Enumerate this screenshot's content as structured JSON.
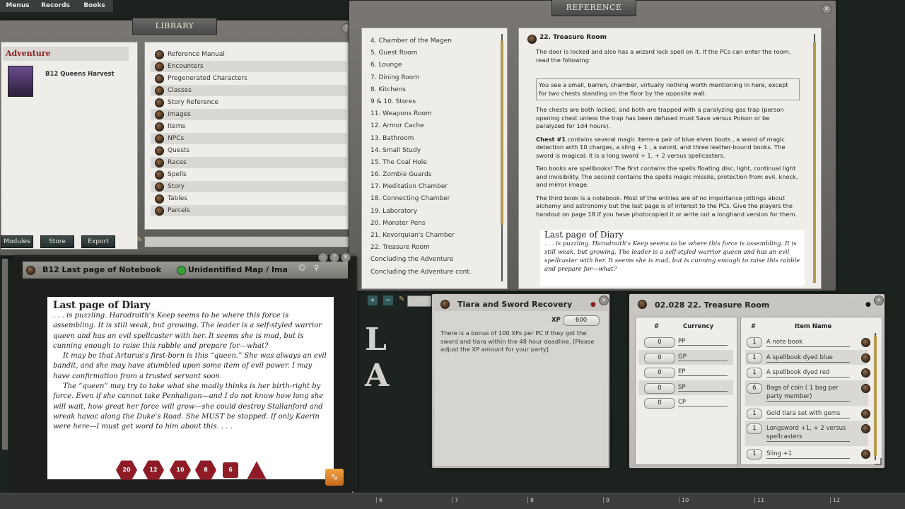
{
  "top_menu": [
    "Menus",
    "Records",
    "Books"
  ],
  "library": {
    "title": "LIBRARY",
    "adventure_header": "Adventure",
    "module_name": "B12 Queens Harvest",
    "items": [
      "Reference Manual",
      "Encounters",
      "Pregenerated Characters",
      "Classes",
      "Story Reference",
      "Images",
      "Items",
      "NPCs",
      "Quests",
      "Races",
      "Spells",
      "Story",
      "Tables",
      "Parcels"
    ],
    "buttons": {
      "modules": "Modules",
      "store": "Store",
      "export": "Export"
    }
  },
  "reference": {
    "title": "REFERENCE",
    "list": [
      "4. Chamber of the Magen",
      "5. Guest Room",
      "6. Lounge",
      "7. Dining Room",
      "8. Kitchens",
      "9 & 10. Stores",
      "11. Weapons Room",
      "12. Armor Cache",
      "13. Bathroom",
      "14. Small Study",
      "15. The Coal Hole",
      "16. Zombie Guards",
      "17. Meditation Chamber",
      "18. Connecting Chamber",
      "19. Laboratory",
      "20. Monster Pens",
      "21. Kevorquian's Chamber",
      "22. Treasure Room",
      "Concluding the Adventure",
      "Concluding the Adventure cont."
    ],
    "page_title": "22. Treasure Room",
    "para1": "The door is locked and also has a wizard lock spell on it. If the PCs can enter the room, read the following:",
    "boxed": "You see a small, barren, chamber, virtually nothing worth mentioning in here, except for two chests standing on the floor by the opposite wall.",
    "para2": "The chests are both locked, and both are trapped with a paralyzing gas trap (person opening chest unless the trap has been defused must Save versus Poison or be paralyzed for 1d4 hours).",
    "para3_bold": "Chest #1",
    "para3": " contains several magic items-a pair of blue elven boots , a wand of magic detection with 10 charges, a sling + 1 , a sword, and three leather-bound books. The sword is magical: it is a long sword + 1, + 2 versus spellcasters.",
    "para4": "Two books are spellbooks! The first contains the spells floating disc, light, continual light and invisibility. The second contains the spells magic missile, protection from evil, knock, and mirror image.",
    "para5": "The third book is a notebook. Most of the entries are of no importance jottings about alchemy and astronomy but the last page is of interest to the PCs. Give the players the handout on page 18 if you have photocopied it or write out a longhand version for them.",
    "diary_title": "Last page of Diary",
    "diary_text": ". . . is puzzling. Haradraith's Keep seems to be where this force is assembling. It is still weak, but growing. The leader is a self-styled warrior queen and has an evil spellcaster with her. It seems she is mad, but is cunning enough to raise this rabble and prepare for—what?"
  },
  "notebook": {
    "tab1": "B12 Last page of Notebook",
    "tab2": "Unidentified Map / Ima",
    "diary_title": "Last page of Diary",
    "para1": ". . . is puzzling. Haradraith's Keep seems to be where this force is assembling. It is still weak, but growing. The leader is a self-styled warrior queen and has an evil spellcaster with her. It seems she is mad, but is cunning enough to raise this rabble and prepare for—what?",
    "para2": "It may be that Arturus's first-born is this “queen.” She was always an evil bandit, and she may have stumbled upon some item of evil power. I may have confirmation from a trusted servant soon.",
    "para3": "The “queen” may try to take what she madly thinks is her birth-right by force. Even if she cannot take Penhaligon—and I do not know how long she will wait, how great her force will grow—she could destroy Stallanford and wreak havoc along the Duke's Road. She MUST be stopped. If only Kaerin were here—I must get word to him about this. . . ."
  },
  "dice": [
    "20",
    "12",
    "10",
    "8",
    "6",
    ""
  ],
  "map_letters": "L A",
  "quest": {
    "title": "Tiara and Sword Recovery",
    "xp_label": "XP",
    "xp": "600",
    "text": "There is a bonus of 100 XPs per PC if they got the sword and tiara within the 48 hour deadline. [Please adjust the XP amount for your party]"
  },
  "treasure": {
    "title": "02.028 22. Treasure Room",
    "currency_headers": {
      "num": "#",
      "name": "Currency"
    },
    "currency": [
      {
        "qty": "0",
        "name": "PP"
      },
      {
        "qty": "0",
        "name": "GP"
      },
      {
        "qty": "0",
        "name": "EP"
      },
      {
        "qty": "0",
        "name": "SP"
      },
      {
        "qty": "0",
        "name": "CP"
      }
    ],
    "item_headers": {
      "num": "#",
      "name": "Item Name"
    },
    "items": [
      {
        "qty": "1",
        "name": "A note book"
      },
      {
        "qty": "1",
        "name": "A spellbook dyed blue"
      },
      {
        "qty": "1",
        "name": "A spellbook dyed red"
      },
      {
        "qty": "6",
        "name": "Bags of coin ( 1 bag per party member)"
      },
      {
        "qty": "1",
        "name": "Gold tiara set with gems"
      },
      {
        "qty": "1",
        "name": "Longsword +1, + 2 versus spellcasters"
      },
      {
        "qty": "1",
        "name": "Sling +1"
      }
    ]
  },
  "ruler": [
    "6",
    "7",
    "8",
    "9",
    "10",
    "11",
    "12"
  ]
}
